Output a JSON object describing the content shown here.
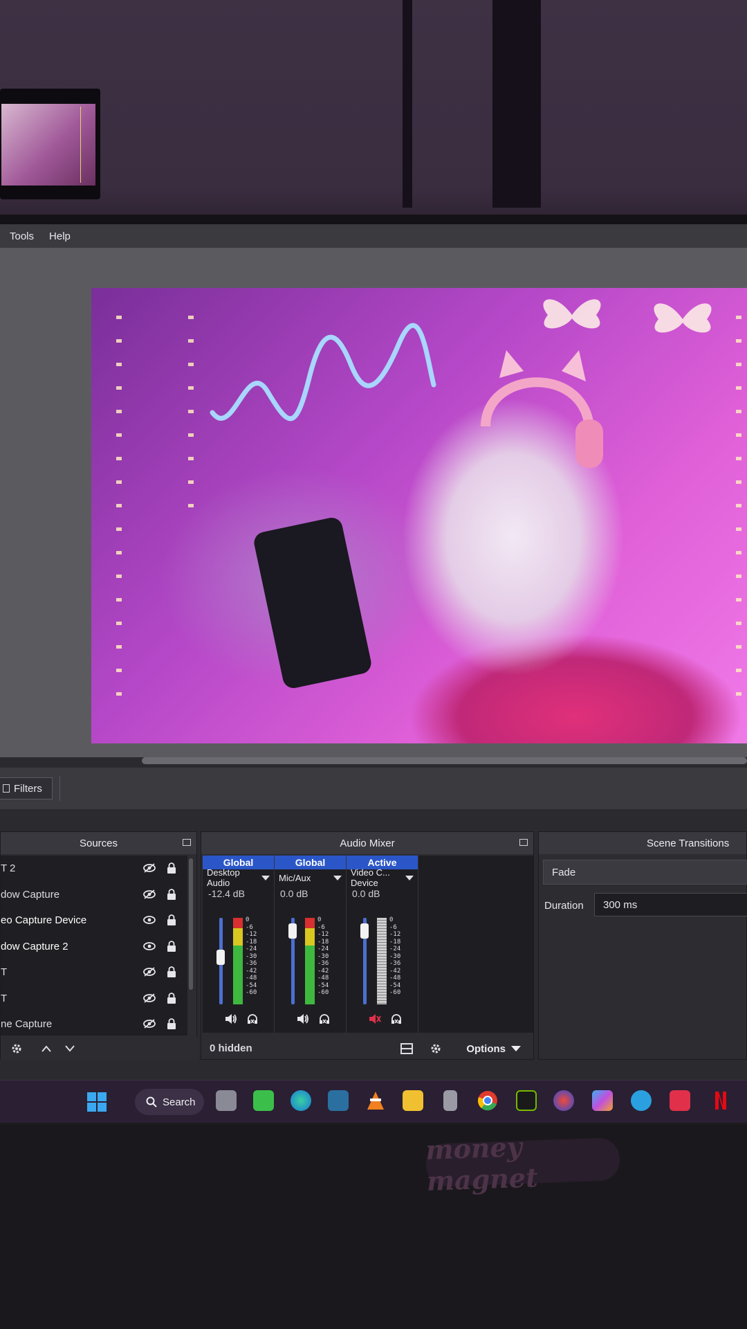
{
  "menu": {
    "items": [
      "Tools",
      "Help"
    ]
  },
  "toolbar": {
    "filters_label": "Filters"
  },
  "sources": {
    "title": "Sources",
    "items": [
      {
        "label": "T 2",
        "visible": false,
        "locked": true
      },
      {
        "label": "dow Capture",
        "visible": false,
        "locked": true
      },
      {
        "label": "eo Capture Device",
        "visible": true,
        "locked": true
      },
      {
        "label": "dow Capture 2",
        "visible": true,
        "locked": true
      },
      {
        "label": "T",
        "visible": false,
        "locked": true
      },
      {
        "label": "T",
        "visible": false,
        "locked": true
      },
      {
        "label": "ne Capture",
        "visible": false,
        "locked": true
      }
    ]
  },
  "mixer": {
    "title": "Audio Mixer",
    "channels": [
      {
        "scope": "Global",
        "name": "Desktop Audio",
        "db": "-12.4 dB",
        "level": 0.55,
        "muted": false,
        "scope_color": "#2a56c8"
      },
      {
        "scope": "Global",
        "name": "Mic/Aux",
        "db": "0.0 dB",
        "level": 0.92,
        "muted": false,
        "scope_color": "#2a56c8"
      },
      {
        "scope": "Active",
        "name": "Video C... Device",
        "db": "0.0 dB",
        "level": 0.92,
        "muted": true,
        "scope_color": "#2a56c8"
      }
    ],
    "scale": [
      "0",
      "-6",
      "-12",
      "-18",
      "-24",
      "-30",
      "-36",
      "-42",
      "-48",
      "-54",
      "-60"
    ],
    "hidden_label": "0 hidden",
    "options_label": "Options"
  },
  "transitions": {
    "title": "Scene Transitions",
    "selected": "Fade",
    "duration_label": "Duration",
    "duration_value": "300 ms"
  },
  "taskbar": {
    "search_label": "Search",
    "icons": [
      "windows-start-icon",
      "search-icon",
      "file-manager-icon",
      "spreadsheet-icon",
      "edge-icon",
      "installer-icon",
      "vlc-icon",
      "folder-icon",
      "microphone-icon",
      "chrome-icon",
      "nvidia-icon",
      "app-icon",
      "copilot-icon",
      "telegram-icon",
      "tiktok-icon",
      "netflix-icon"
    ]
  },
  "sticker_text": "money magnet",
  "colors": {
    "accent": "#2a56c8",
    "meter_green": "#3fb83f",
    "meter_yellow": "#d8c820",
    "meter_red": "#d83030",
    "muted_red": "#e0304a"
  }
}
